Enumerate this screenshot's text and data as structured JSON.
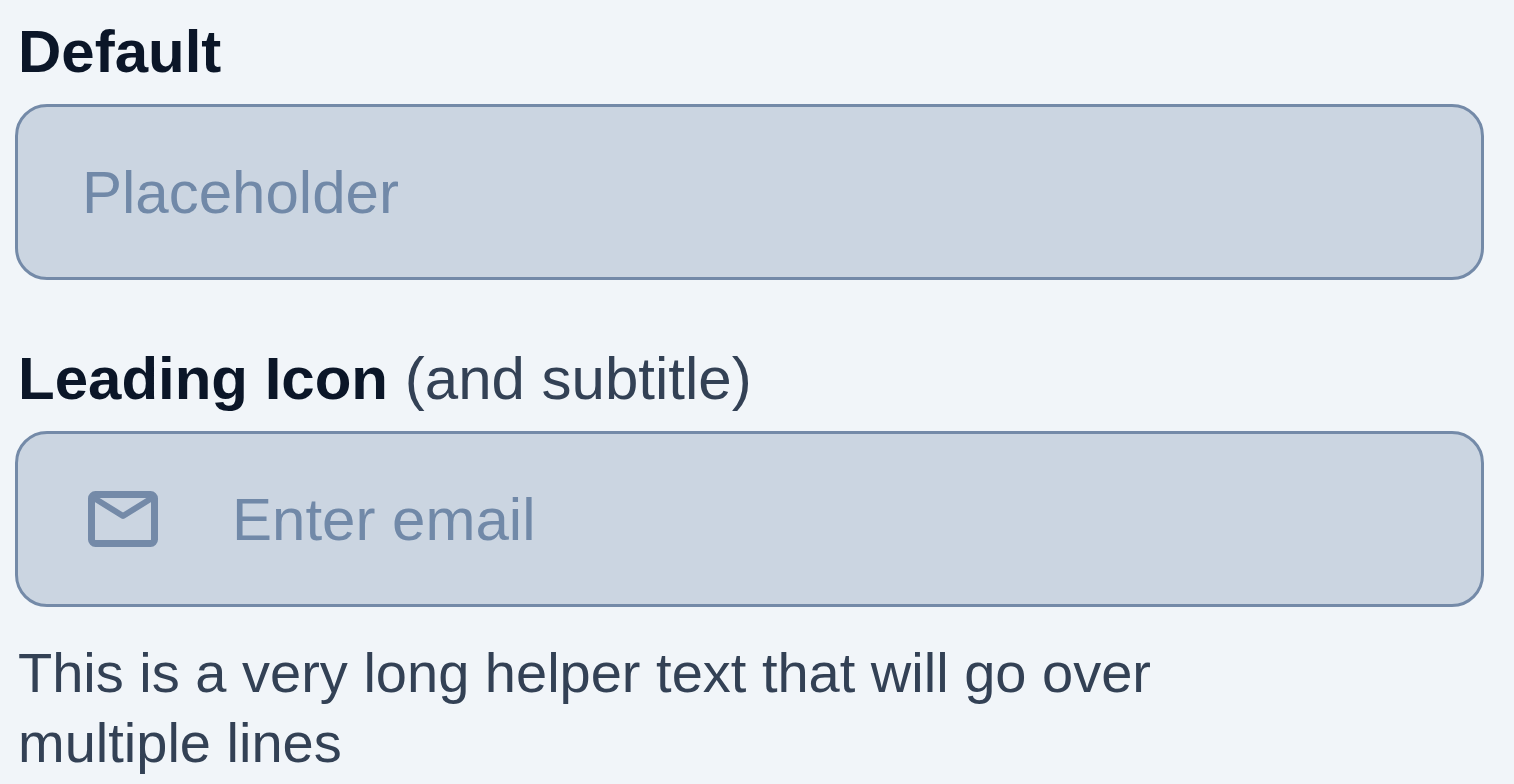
{
  "fields": [
    {
      "kind": "plain",
      "label": "Default",
      "placeholder": "Placeholder"
    },
    {
      "kind": "leading-icon",
      "label": "Leading Icon",
      "subtitle": "(and subtitle)",
      "placeholder": "Enter email",
      "helper": "This is a very long helper text that will go over multiple lines"
    }
  ]
}
